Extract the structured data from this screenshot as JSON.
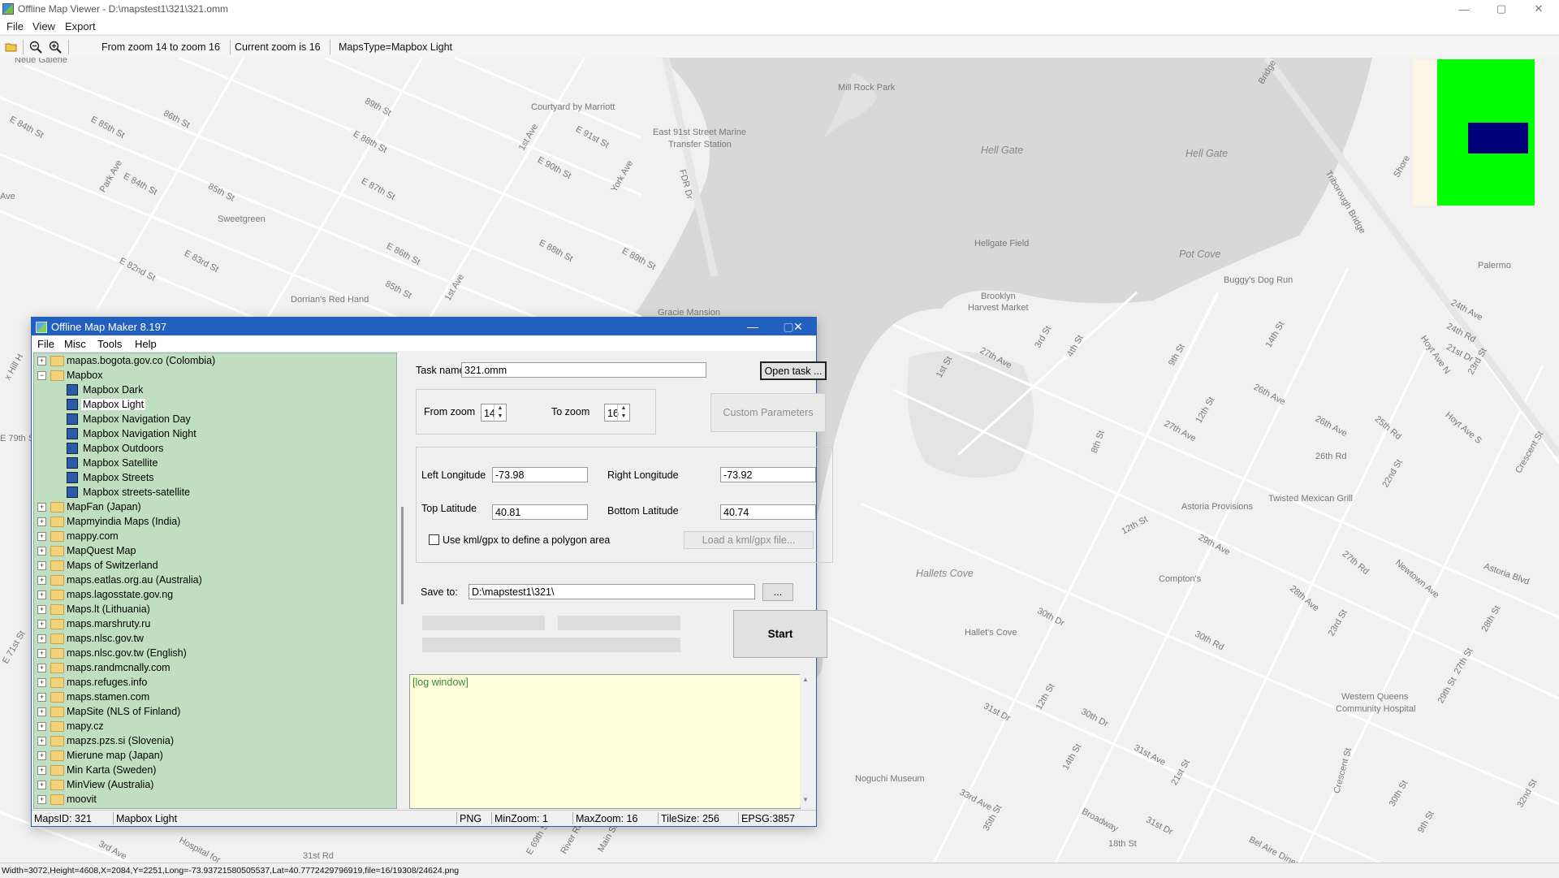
{
  "window": {
    "title": "Offline Map Viewer - D:\\mapstest1\\321\\321.omm",
    "menu": [
      "File",
      "View",
      "Export"
    ],
    "controls": [
      "—",
      "▢",
      "✕"
    ]
  },
  "toolbar": {
    "icons": [
      "open-folder-icon",
      "zoom-out-icon",
      "zoom-in-icon"
    ],
    "zoom_range": "From zoom 14 to zoom 16",
    "current_zoom": "Current zoom is 16",
    "maps_type": "MapsType=Mapbox Light"
  },
  "map": {
    "labels": [
      "Neue Galerie",
      "E 84th St",
      "E 85th St",
      "86th St",
      "89th St",
      "E 88th St",
      "Courtyard by Marriott",
      "1st Ave",
      "E 91st St",
      "East 91st Street Marine",
      "Transfer Station",
      "Mill Rock Park",
      "E 90th St",
      "York Ave",
      "FDR Dr",
      "Park Ave",
      "E 84th St",
      "85th St",
      "E 87th St",
      "Sweetgreen",
      "E 82nd St",
      "E 83rd St",
      "E 86th St",
      "E 88th St",
      "E 89th St",
      "Dorrian's Red Hand",
      "85th St",
      "1st Ave",
      "Gracie Mansion",
      "Hellgate Field",
      "Brooklyn",
      "Harvest Market",
      "Buggy's Dog Run",
      "27th Ave",
      "3rd St",
      "4th St",
      "1st St",
      "9th St",
      "14th St",
      "12th St",
      "26th Ave",
      "27th Ave",
      "8th St",
      "26th Ave",
      "26th Rd",
      "25th Rd",
      "Hoyt Ave S",
      "Hoyt Ave N",
      "24th Ave",
      "24th Rd",
      "Palermo",
      "23rd St",
      "21st Dr",
      "Triborough Bridge",
      "Bridge",
      "Shore",
      "Crescent St",
      "22nd St",
      "Astoria Provisions",
      "Twisted Mexican Grill",
      "12th St",
      "29th Ave",
      "Compton's",
      "27th Rd",
      "Newtown Ave",
      "Astoria Blvd",
      "28th Ave",
      "23rd St",
      "28th St",
      "30th Dr",
      "30th Rd",
      "Hallet's Cove",
      "Western Queens",
      "Community Hospital",
      "29th St",
      "27th St",
      "12th St",
      "31st Dr",
      "30th Dr",
      "31st Ave",
      "14th St",
      "21st St",
      "Crescent St",
      "30th St",
      "32nd St",
      "Noguchi Museum",
      "33rd Ave",
      "Broadway",
      "31st Dr",
      "35th St",
      "9th St",
      "18th St",
      "Bel Aire Diner",
      "31st Rd",
      "Hospital for",
      "E 69th St",
      "River Rd",
      "Main St",
      "E 71st St",
      "3rd Ave",
      "E 79th St",
      "x Hill H",
      "Ave",
      "nd St"
    ],
    "water_labels": [
      "Hell Gate",
      "Hell Gate",
      "Pot Cove",
      "Hallets Cove"
    ],
    "minimap_colors": {
      "background": "#fdf6e8",
      "coverage": "#00ff00",
      "viewport": "#00007a"
    }
  },
  "statusbar": {
    "text": "Width=3072,Height=4608,X=2084,Y=2251,Long=-73.93721580505537,Lat=40.7772429796919,file=16/19308/24624.png"
  },
  "dialog": {
    "title": "Offline Map Maker 8.197",
    "menu": [
      "File",
      "Misc",
      "Tools",
      "Help"
    ],
    "tree": [
      {
        "label": "mapas.bogota.gov.co (Colombia)",
        "type": "folder",
        "expanded": false
      },
      {
        "label": "Mapbox",
        "type": "folder",
        "expanded": true
      },
      {
        "label": "Mapbox Dark",
        "type": "map",
        "child": true
      },
      {
        "label": "Mapbox Light",
        "type": "map",
        "child": true,
        "selected": true
      },
      {
        "label": "Mapbox Navigation Day",
        "type": "map",
        "child": true
      },
      {
        "label": "Mapbox Navigation Night",
        "type": "map",
        "child": true
      },
      {
        "label": "Mapbox Outdoors",
        "type": "map",
        "child": true
      },
      {
        "label": "Mapbox Satellite",
        "type": "map",
        "child": true
      },
      {
        "label": "Mapbox Streets",
        "type": "map",
        "child": true
      },
      {
        "label": "Mapbox streets-satellite",
        "type": "map",
        "child": true
      },
      {
        "label": "MapFan (Japan)",
        "type": "folder"
      },
      {
        "label": "Mapmyindia Maps (India)",
        "type": "folder"
      },
      {
        "label": "mappy.com",
        "type": "folder"
      },
      {
        "label": "MapQuest Map",
        "type": "folder"
      },
      {
        "label": "Maps of Switzerland",
        "type": "folder"
      },
      {
        "label": "maps.eatlas.org.au (Australia)",
        "type": "folder"
      },
      {
        "label": "maps.lagosstate.gov.ng",
        "type": "folder"
      },
      {
        "label": "Maps.lt (Lithuania)",
        "type": "folder"
      },
      {
        "label": "maps.marshruty.ru",
        "type": "folder"
      },
      {
        "label": "maps.nlsc.gov.tw",
        "type": "folder"
      },
      {
        "label": "maps.nlsc.gov.tw (English)",
        "type": "folder"
      },
      {
        "label": "maps.randmcnally.com",
        "type": "folder"
      },
      {
        "label": "maps.refuges.info",
        "type": "folder"
      },
      {
        "label": "maps.stamen.com",
        "type": "folder"
      },
      {
        "label": "MapSite (NLS of Finland)",
        "type": "folder"
      },
      {
        "label": "mapy.cz",
        "type": "folder"
      },
      {
        "label": "mapzs.pzs.si (Slovenia)",
        "type": "folder"
      },
      {
        "label": "Mierune map (Japan)",
        "type": "folder"
      },
      {
        "label": "Min Karta (Sweden)",
        "type": "folder"
      },
      {
        "label": "MinView (Australia)",
        "type": "folder"
      },
      {
        "label": "moovit",
        "type": "folder"
      }
    ],
    "task_name_label": "Task name",
    "task_name": "321.omm",
    "open_task": "Open task ...",
    "from_zoom_label": "From zoom",
    "from_zoom": "14",
    "to_zoom_label": "To zoom",
    "to_zoom": "16",
    "custom_params": "Custom Parameters",
    "left_lon_label": "Left Longitude",
    "left_lon": "-73.98",
    "right_lon_label": "Right Longitude",
    "right_lon": "-73.92",
    "top_lat_label": "Top Latitude",
    "top_lat": "40.81",
    "bottom_lat_label": "Bottom Latitude",
    "bottom_lat": "40.74",
    "kml_label": "Use kml/gpx to define a polygon area",
    "kml_checked": false,
    "load_kml": "Load a kml/gpx file...",
    "save_to_label": "Save to:",
    "save_to": "D:\\mapstest1\\321\\",
    "browse": "...",
    "start": "Start",
    "log": "[log window]",
    "status": {
      "maps_id": "MapsID: 321",
      "name": "Mapbox Light",
      "format": "PNG",
      "min_zoom": "MinZoom: 1",
      "max_zoom": "MaxZoom: 16",
      "tile_size": "TileSize: 256",
      "epsg": "EPSG:3857"
    }
  }
}
